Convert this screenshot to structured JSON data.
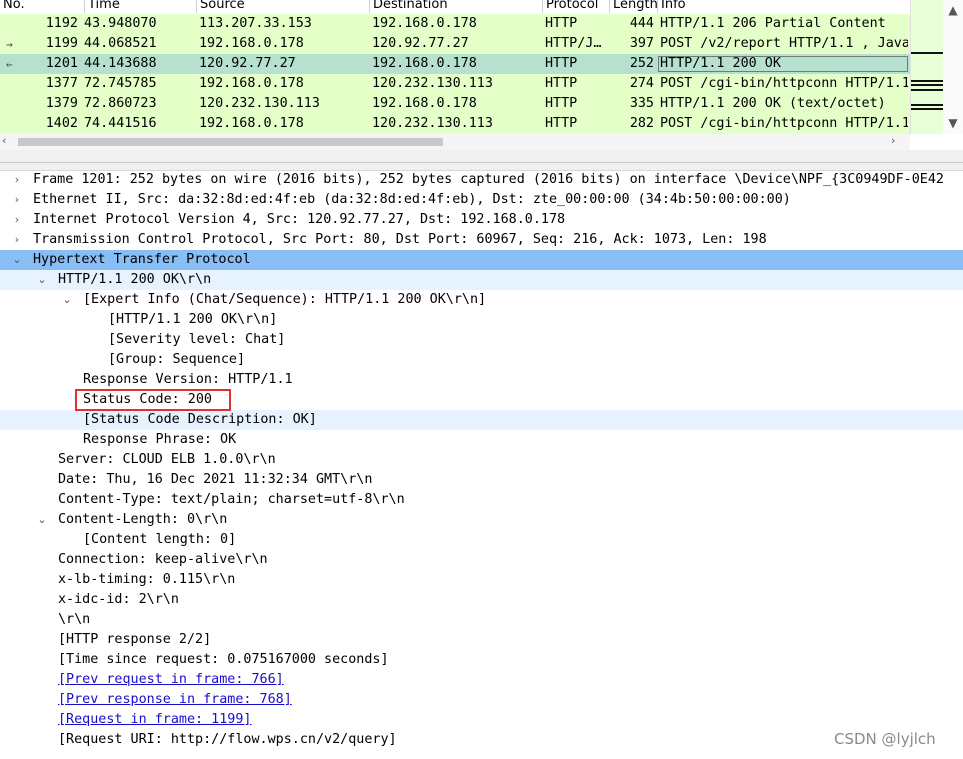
{
  "packet_list": {
    "columns": [
      "No.",
      "Time",
      "Source",
      "Destination",
      "Protocol",
      "Length",
      "Info"
    ],
    "rows": [
      {
        "no": "1192",
        "time": "43.948070",
        "source": "113.207.33.153",
        "destination": "192.168.0.178",
        "protocol": "HTTP",
        "length": "444",
        "info": "HTTP/1.1 206 Partial Content",
        "mark": ""
      },
      {
        "no": "1199",
        "time": "44.068521",
        "source": "192.168.0.178",
        "destination": "120.92.77.27",
        "protocol": "HTTP/J…",
        "length": "397",
        "info": "POST /v2/report HTTP/1.1 , Java",
        "mark": "→"
      },
      {
        "no": "1201",
        "time": "44.143688",
        "source": "120.92.77.27",
        "destination": "192.168.0.178",
        "protocol": "HTTP",
        "length": "252",
        "info": "HTTP/1.1 200 OK",
        "mark": "←"
      },
      {
        "no": "1377",
        "time": "72.745785",
        "source": "192.168.0.178",
        "destination": "120.232.130.113",
        "protocol": "HTTP",
        "length": "274",
        "info": "POST /cgi-bin/httpconn HTTP/1.1",
        "mark": ""
      },
      {
        "no": "1379",
        "time": "72.860723",
        "source": "120.232.130.113",
        "destination": "192.168.0.178",
        "protocol": "HTTP",
        "length": "335",
        "info": "HTTP/1.1 200 OK  (text/octet)",
        "mark": ""
      },
      {
        "no": "1402",
        "time": "74.441516",
        "source": "192.168.0.178",
        "destination": "120.232.130.113",
        "protocol": "HTTP",
        "length": "282",
        "info": "POST /cgi-bin/httpconn HTTP/1.1",
        "mark": ""
      }
    ],
    "selected_row": 2
  },
  "tree": [
    {
      "text": "Frame 1201: 252 bytes on wire (2016 bits), 252 bytes captured (2016 bits) on interface \\Device\\NPF_{3C0949DF-0E42",
      "arrow": "›"
    },
    {
      "text": "Ethernet II, Src: da:32:8d:ed:4f:eb (da:32:8d:ed:4f:eb), Dst: zte_00:00:00 (34:4b:50:00:00:00)",
      "arrow": "›"
    },
    {
      "text": "Internet Protocol Version 4, Src: 120.92.77.27, Dst: 192.168.0.178",
      "arrow": "›"
    },
    {
      "text": "Transmission Control Protocol, Src Port: 80, Dst Port: 60967, Seq: 216, Ack: 1073, Len: 198",
      "arrow": "›"
    },
    {
      "text": "Hypertext Transfer Protocol",
      "arrow": "⌄"
    },
    {
      "text": "HTTP/1.1 200 OK\\r\\n",
      "arrow": "⌄"
    },
    {
      "text": "[Expert Info (Chat/Sequence): HTTP/1.1 200 OK\\r\\n]",
      "arrow": "⌄"
    },
    {
      "text": "[HTTP/1.1 200 OK\\r\\n]",
      "arrow": ""
    },
    {
      "text": "[Severity level: Chat]",
      "arrow": ""
    },
    {
      "text": "[Group: Sequence]",
      "arrow": ""
    },
    {
      "text": "Response Version: HTTP/1.1",
      "arrow": ""
    },
    {
      "text": "Status Code: 200",
      "arrow": ""
    },
    {
      "text": "[Status Code Description: OK]",
      "arrow": ""
    },
    {
      "text": "Response Phrase: OK",
      "arrow": ""
    },
    {
      "text": "Server: CLOUD ELB 1.0.0\\r\\n",
      "arrow": ""
    },
    {
      "text": "Date: Thu, 16 Dec 2021 11:32:34 GMT\\r\\n",
      "arrow": ""
    },
    {
      "text": "Content-Type: text/plain; charset=utf-8\\r\\n",
      "arrow": ""
    },
    {
      "text": "Content-Length: 0\\r\\n",
      "arrow": "⌄"
    },
    {
      "text": "[Content length: 0]",
      "arrow": ""
    },
    {
      "text": "Connection: keep-alive\\r\\n",
      "arrow": ""
    },
    {
      "text": "x-lb-timing: 0.115\\r\\n",
      "arrow": ""
    },
    {
      "text": "x-idc-id: 2\\r\\n",
      "arrow": ""
    },
    {
      "text": "\\r\\n",
      "arrow": ""
    },
    {
      "text": "[HTTP response 2/2]",
      "arrow": ""
    },
    {
      "text": "[Time since request: 0.075167000 seconds]",
      "arrow": ""
    },
    {
      "text": "[Prev request in frame: 766]",
      "arrow": ""
    },
    {
      "text": "[Prev response in frame: 768]",
      "arrow": ""
    },
    {
      "text": "[Request in frame: 1199]",
      "arrow": ""
    },
    {
      "text": "[Request URI: http://flow.wps.cn/v2/query]",
      "arrow": ""
    }
  ],
  "scroll_icons": {
    "up": "▲",
    "down": "▼",
    "left": "‹",
    "right": "›"
  },
  "watermark": "CSDN @lyjlch",
  "colors": {
    "row_bg": "#e4ffc7",
    "selected_row_bg": "#b6e1d1",
    "tree_highlight": "#88bdf5",
    "tree_subhighlight": "#e7f2ff",
    "annotation_box": "#e03030",
    "link": "#1a0dcc"
  }
}
